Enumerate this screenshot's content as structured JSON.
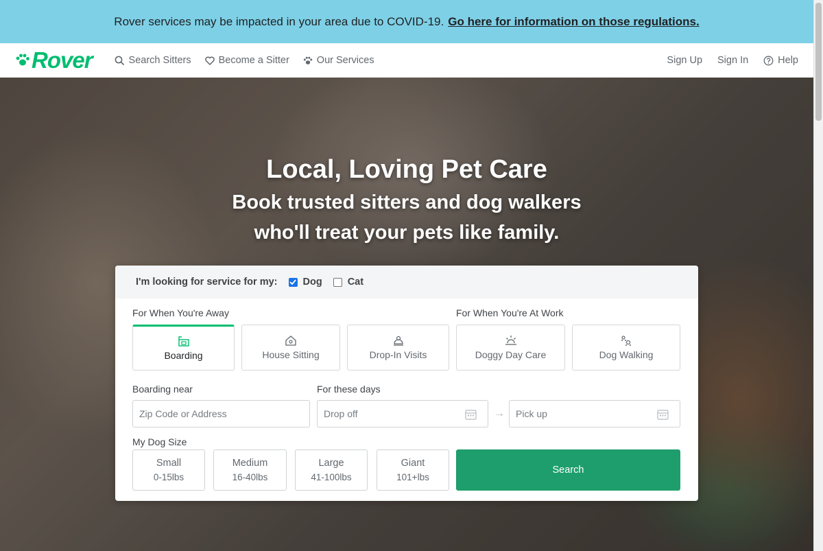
{
  "banner": {
    "text": "Rover services may be impacted in your area due to COVID-19.",
    "link": "Go here for information on those regulations."
  },
  "nav": {
    "logo": "Rover",
    "search_sitters": "Search Sitters",
    "become_sitter": "Become a Sitter",
    "our_services": "Our Services",
    "sign_up": "Sign Up",
    "sign_in": "Sign In",
    "help": "Help"
  },
  "hero": {
    "title": "Local, Loving Pet Care",
    "subtitle_line1": "Book trusted sitters and dog walkers",
    "subtitle_line2": "who'll treat your pets like family."
  },
  "search": {
    "pet_prompt": "I'm looking for service for my:",
    "pets": [
      {
        "label": "Dog",
        "checked": true
      },
      {
        "label": "Cat",
        "checked": false
      }
    ],
    "away_label": "For When You're Away",
    "work_label": "For When You're At Work",
    "services": [
      {
        "label": "Boarding",
        "icon": "boarding-icon"
      },
      {
        "label": "House Sitting",
        "icon": "house-sitting-icon"
      },
      {
        "label": "Drop-In Visits",
        "icon": "drop-in-icon"
      },
      {
        "label": "Doggy Day Care",
        "icon": "sun-icon"
      },
      {
        "label": "Dog Walking",
        "icon": "paw-prints-icon"
      }
    ],
    "near_label": "Boarding near",
    "near_placeholder": "Zip Code or Address",
    "days_label": "For these days",
    "drop_off": "Drop off",
    "pick_up": "Pick up",
    "size_label": "My Dog Size",
    "sizes": [
      {
        "name": "Small",
        "range": "0-15lbs"
      },
      {
        "name": "Medium",
        "range": "16-40lbs"
      },
      {
        "name": "Large",
        "range": "41-100lbs"
      },
      {
        "name": "Giant",
        "range": "101+lbs"
      }
    ],
    "search_button": "Search"
  },
  "colors": {
    "brand": "#00bd70",
    "banner": "#7ed0e6",
    "search_button": "#1e9e6c"
  }
}
